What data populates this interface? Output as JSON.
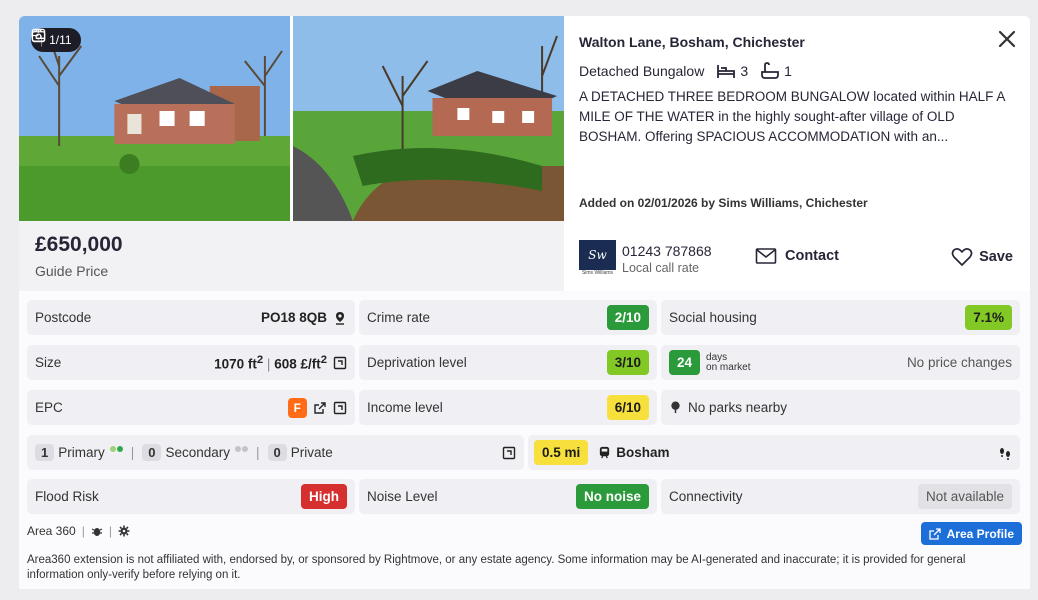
{
  "listing": {
    "photo_counter": "1/11",
    "price": "£650,000",
    "price_qualifier": "Guide Price",
    "address": "Walton Lane, Bosham, Chichester",
    "property_type": "Detached Bungalow",
    "bedrooms": "3",
    "bathrooms": "1",
    "description": "A DETACHED THREE BEDROOM BUNGALOW located within HALF A MILE OF THE WATER in the highly sought-after village of OLD BOSHAM. Offering SPACIOUS ACCOMMODATION with an...",
    "added": "Added on 02/01/2026 by Sims Williams, Chichester",
    "agent_logo_text": "Sw",
    "agent_logo_small": "Sims Williams",
    "phone": "01243 787868",
    "phone_note": "Local call rate",
    "contact_label": "Contact",
    "save_label": "Save"
  },
  "area360": {
    "postcode_label": "Postcode",
    "postcode_value": "PO18 8QB",
    "crime_label": "Crime rate",
    "crime_value": "2/10",
    "social_label": "Social housing",
    "social_value": "7.1%",
    "size_label": "Size",
    "size_ft": "1070 ft",
    "size_sup": "2",
    "size_price": "608 £/ft",
    "size_price_sup": "2",
    "deprivation_label": "Deprivation level",
    "deprivation_value": "3/10",
    "days_number": "24",
    "days_line1": "days",
    "days_line2": "on market",
    "price_changes": "No price changes",
    "epc_label": "EPC",
    "epc_value": "F",
    "income_label": "Income level",
    "income_value": "6/10",
    "parks": "No parks nearby",
    "schools": {
      "primary_count": "1",
      "primary_label": "Primary",
      "secondary_count": "0",
      "secondary_label": "Secondary",
      "private_count": "0",
      "private_label": "Private"
    },
    "station_distance": "0.5 mi",
    "station_name": "Bosham",
    "flood_label": "Flood Risk",
    "flood_value": "High",
    "noise_label": "Noise Level",
    "noise_value": "No noise",
    "connectivity_label": "Connectivity",
    "connectivity_value": "Not available",
    "footer_brand": "Area 360",
    "area_profile_label": "Area Profile",
    "disclaimer": "Area360 extension is not affiliated with, endorsed by, or sponsored by Rightmove, or any estate agency. Some information may be AI-generated and inaccurate; it is provided for general information only-verify before relying on it."
  },
  "colors": {
    "dark_green": "#2a9a3a",
    "light_green": "#82c926",
    "yellow": "#f7df3c",
    "red": "#d62f2f",
    "orange": "#ff6b16",
    "blue": "#1c6fd9"
  }
}
